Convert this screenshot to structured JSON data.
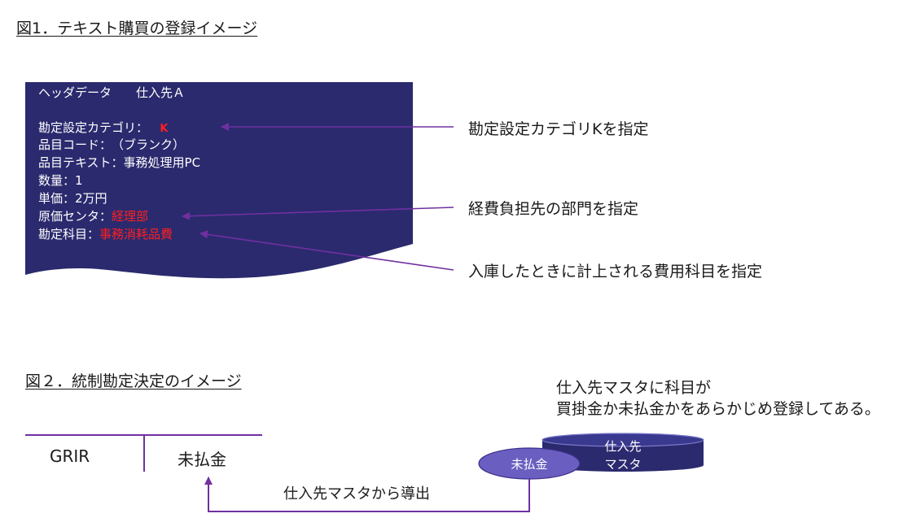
{
  "fig1": {
    "title": "図1．テキスト購買の登録イメージ",
    "doc": {
      "header": "ヘッダデータ　　仕入先Ａ",
      "account_category_label": "勘定設定カテゴリ：",
      "account_category_value": "K",
      "item_code": "品目コード：　（ブランク）",
      "item_text": "品目テキスト：事務処理用PC",
      "quantity": "数量：1",
      "unit_price": "単価：2万円",
      "cost_center_label": "原価センタ：",
      "cost_center_value": "経理部",
      "gl_account_label": "勘定科目：",
      "gl_account_value": "事務消耗品費"
    },
    "annotations": {
      "category": "勘定設定カテゴリKを指定",
      "department": "経費負担先の部門を指定",
      "account": "入庫したときに計上される費用科目を指定"
    },
    "colors": {
      "doc_fill": "#2b2a6e",
      "arrow": "#7030a0",
      "highlight": "#ff1f1f"
    }
  },
  "fig2": {
    "title": "図２．統制勘定決定のイメージ",
    "t_account": {
      "left": "GRIR",
      "right": "未払金"
    },
    "note_line1": "仕入先マスタに科目が",
    "note_line2": "買掛金か未払金かをあらかじめ登録してある。",
    "db_label_line1": "仕入先",
    "db_label_line2": "マスタ",
    "ellipse_label": "未払金",
    "arrow_label": "仕入先マスタから導出",
    "colors": {
      "db_fill": "#2b2a6e",
      "ellipse_fill": "#6a5fc0",
      "line": "#7030a0"
    }
  }
}
